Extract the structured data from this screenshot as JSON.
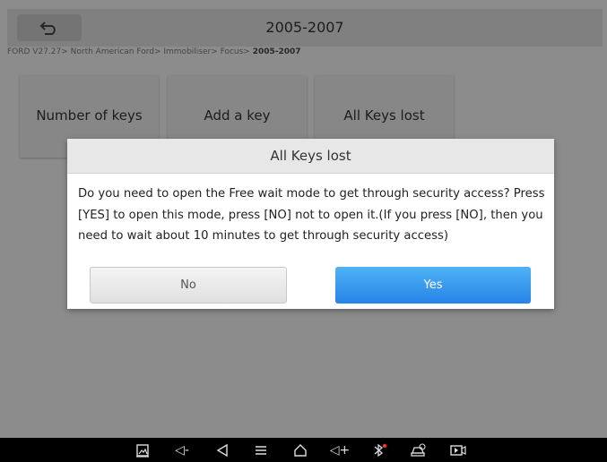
{
  "header": {
    "title": "2005-2007"
  },
  "breadcrumb": {
    "path": "FORD V27.27> North American Ford> Immobiliser> Focus> ",
    "current": "2005-2007"
  },
  "tiles": [
    {
      "label": "Number of keys"
    },
    {
      "label": "Add a key"
    },
    {
      "label": "All Keys lost"
    }
  ],
  "dialog": {
    "title": "All Keys lost",
    "message": "Do you need to open the Free wait mode to get through security access? Press [YES] to open this mode, press [NO] not to open it.(If you press [NO], then you need to wait about 10 minutes to get through security access)",
    "no_label": "No",
    "yes_label": "Yes"
  },
  "navbar": {
    "items": [
      "gallery-icon",
      "volume-down-icon",
      "back-icon",
      "menu-icon",
      "home-icon",
      "volume-up-icon",
      "bluetooth-icon",
      "vci-icon",
      "screen-record-icon"
    ],
    "volume_down_label": "◁-",
    "volume_up_label": "◁+"
  },
  "colors": {
    "primary_button": "#2f8ff0",
    "dialog_header": "#e7e7e7"
  }
}
